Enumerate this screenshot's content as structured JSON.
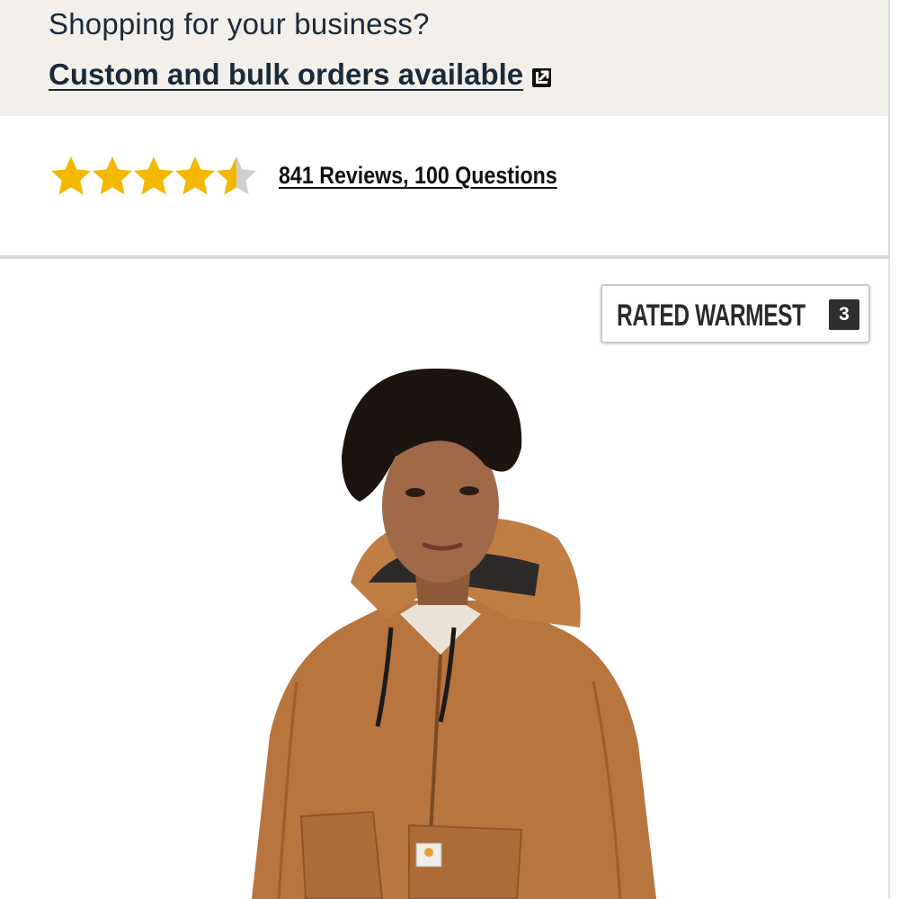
{
  "business_banner": {
    "title": "Shopping for your business?",
    "link_label": "Custom and bulk orders available",
    "link_icon": "external-link-icon"
  },
  "rating": {
    "stars_value": 4.5,
    "stars_max": 5,
    "reviews_link_label": "841 Reviews, 100 Questions",
    "star_color": "#f5b800",
    "empty_star_color": "#cfcfcf"
  },
  "product_image": {
    "badge_text": "RATED WARMEST",
    "badge_number": "3",
    "jacket_color": "#b8753e",
    "jacket_label_logo": "carhartt-logo"
  }
}
